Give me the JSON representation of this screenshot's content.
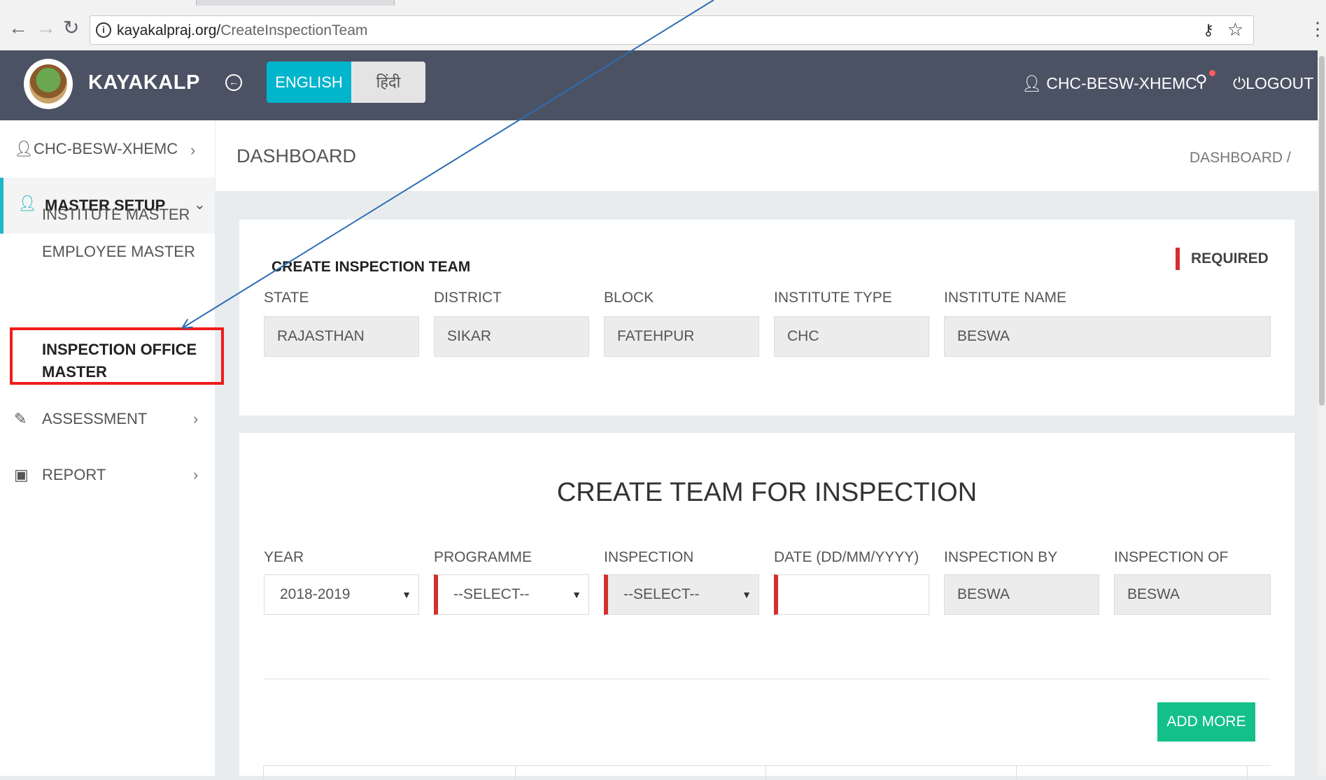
{
  "browser": {
    "url_domain": "kayakalpraj.org/",
    "url_path": "CreateInspectionTeam"
  },
  "header": {
    "brand": "KAYAKALP",
    "lang_english": "ENGLISH",
    "lang_hindi": "हिंदी",
    "user": "CHC-BESW-XHEMC",
    "logout": "LOGOUT"
  },
  "sidebar": {
    "user": "CHC-BESW-XHEMC",
    "master_setup": "MASTER SETUP",
    "sub_items": [
      "INSTITUTE MASTER",
      "EMPLOYEE MASTER",
      "INSPECTION OFFICE MASTER"
    ],
    "assessment": "ASSESSMENT",
    "report": "REPORT"
  },
  "page": {
    "title": "DASHBOARD",
    "breadcrumb": "DASHBOARD  /"
  },
  "team_card": {
    "title": "CREATE INSPECTION TEAM",
    "required": "REQUIRED",
    "fields": [
      {
        "label": "STATE",
        "value": "RAJASTHAN"
      },
      {
        "label": "DISTRICT",
        "value": "SIKAR"
      },
      {
        "label": "BLOCK",
        "value": "FATEHPUR"
      },
      {
        "label": "INSTITUTE TYPE",
        "value": "CHC"
      },
      {
        "label": "INSTITUTE NAME",
        "value": "BESWA"
      }
    ]
  },
  "inspection_card": {
    "title": "CREATE TEAM FOR INSPECTION",
    "fields": [
      {
        "label": "YEAR",
        "value": "2018-2019"
      },
      {
        "label": "PROGRAMME",
        "value": "--SELECT--"
      },
      {
        "label": "INSPECTION",
        "value": "--SELECT--"
      },
      {
        "label": "DATE (DD/MM/YYYY)",
        "value": ""
      },
      {
        "label": "INSPECTION BY",
        "value": "BESWA"
      },
      {
        "label": "INSPECTION OF",
        "value": "BESWA"
      }
    ],
    "add_more": "ADD MORE"
  },
  "colors": {
    "header_bg": "#4b5264",
    "accent": "#00b5cc",
    "add_button": "#13c089",
    "required_marker": "#d32f2f",
    "highlight_box": "#ee1c1c",
    "annotation_arrow": "#2e6db4"
  }
}
